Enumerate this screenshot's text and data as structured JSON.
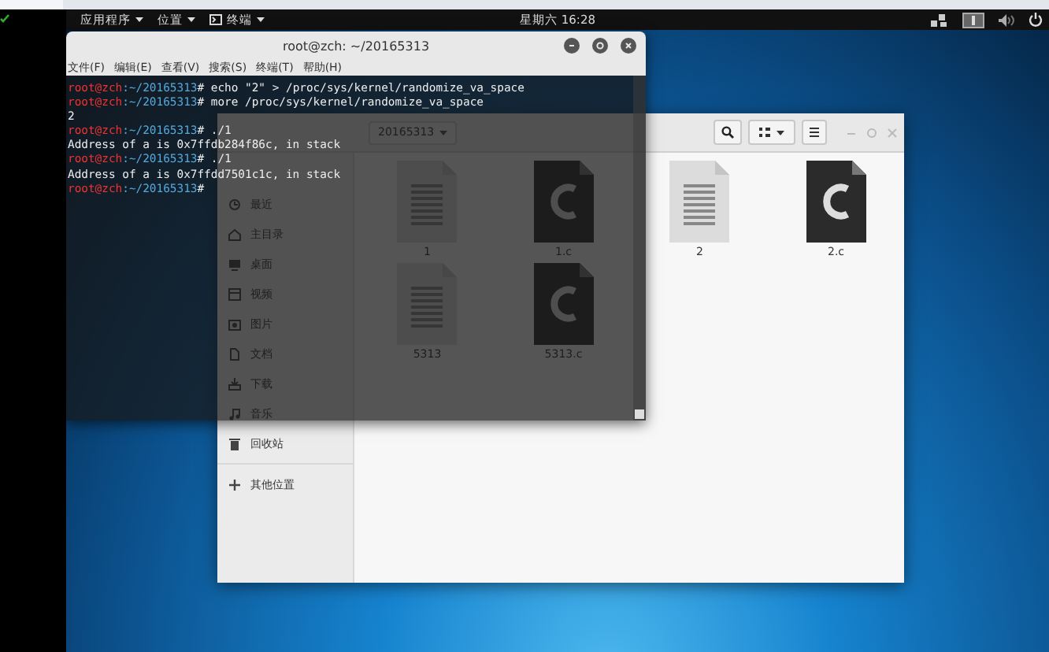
{
  "top_panel": {
    "menus": [
      {
        "label": "应用程序"
      },
      {
        "label": "位置"
      },
      {
        "label": "终端"
      }
    ],
    "clock": "星期六 16:28"
  },
  "terminal": {
    "title": "root@zch: ~/20165313",
    "menu": [
      "文件(F)",
      "编辑(E)",
      "查看(V)",
      "搜索(S)",
      "终端(T)",
      "帮助(H)"
    ],
    "lines": [
      {
        "kind": "prompt",
        "user": "root@zch",
        "path": ":~/20165313",
        "command": "# echo \"2\" > /proc/sys/kernel/randomize_va_space"
      },
      {
        "kind": "prompt",
        "user": "root@zch",
        "path": ":~/20165313",
        "command": "# more /proc/sys/kernel/randomize_va_space"
      },
      {
        "kind": "output",
        "text": "2"
      },
      {
        "kind": "prompt",
        "user": "root@zch",
        "path": ":~/20165313",
        "command": "# ./1"
      },
      {
        "kind": "output",
        "text": "Address of a is 0x7ffdb284f86c, in stack"
      },
      {
        "kind": "prompt",
        "user": "root@zch",
        "path": ":~/20165313",
        "command": "# ./1"
      },
      {
        "kind": "output",
        "text": "Address of a is 0x7ffdd7501c1c, in stack"
      },
      {
        "kind": "prompt",
        "user": "root@zch",
        "path": ":~/20165313",
        "command": "#"
      }
    ]
  },
  "files_window": {
    "breadcrumb": "20165313",
    "sidebar": [
      {
        "label": "最近",
        "kind": "recent"
      },
      {
        "label": "主目录",
        "kind": "home"
      },
      {
        "label": "桌面",
        "kind": "desktop"
      },
      {
        "label": "视频",
        "kind": "video"
      },
      {
        "label": "图片",
        "kind": "picture"
      },
      {
        "label": "文档",
        "kind": "document"
      },
      {
        "label": "下载",
        "kind": "download"
      },
      {
        "label": "音乐",
        "kind": "music"
      },
      {
        "label": "回收站",
        "kind": "trash"
      },
      {
        "label": "其他位置",
        "kind": "other"
      }
    ],
    "files": [
      {
        "name": "1",
        "kind": "text"
      },
      {
        "name": "1.c",
        "kind": "c"
      },
      {
        "name": "2",
        "kind": "text"
      },
      {
        "name": "2.c",
        "kind": "c"
      },
      {
        "name": "5313",
        "kind": "text"
      },
      {
        "name": "5313.c",
        "kind": "c"
      }
    ]
  }
}
